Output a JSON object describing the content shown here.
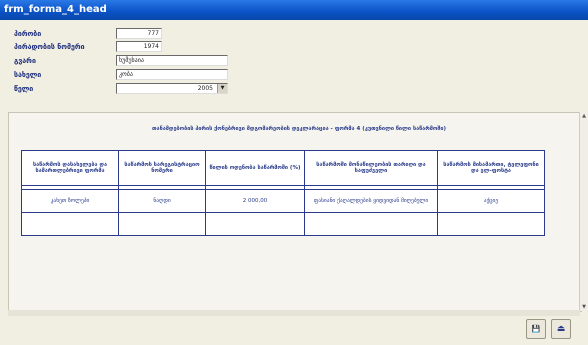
{
  "window": {
    "title": "frm_forma_4_head"
  },
  "form": {
    "field1": {
      "label": "პირობი",
      "value": "777"
    },
    "field2": {
      "label": "პირადობის ნომერი",
      "value": "1974"
    },
    "field3": {
      "label": "გვარი",
      "value": "ხუმუხაია"
    },
    "field4": {
      "label": "სახელი",
      "value": "კობა"
    },
    "field5": {
      "label": "წელი",
      "value": "2005"
    }
  },
  "panel": {
    "heading": "თანამდებობის პირის ქონებრივი მდგომარეობის დეკლარაცია - ფორმა 4 (კუთვნილი წილი საწარმოში)"
  },
  "table": {
    "headers": [
      "საწარმოს დასახელება და სამართლებრივი ფორმა",
      "საწარმოს სარეგისტრაციო ნომერი",
      "წილის ოდენობა საწარმოში (%)",
      "საწარმოში მონაწილეობის თარიღი და საფუძველი",
      "საწარმოს მისამართი, ტელეფონი და ელ-ფოსტა"
    ],
    "rows": [
      [
        "კახეთ ზოლეპი",
        "ნაღდი",
        "2 000,00",
        "ფასიანი ქაღალდების ყიდვიდან მიღებული",
        "აქციე"
      ],
      [
        "",
        "",
        "",
        "",
        ""
      ]
    ]
  },
  "buttons": {
    "save": "💾",
    "exit": "⏏"
  }
}
